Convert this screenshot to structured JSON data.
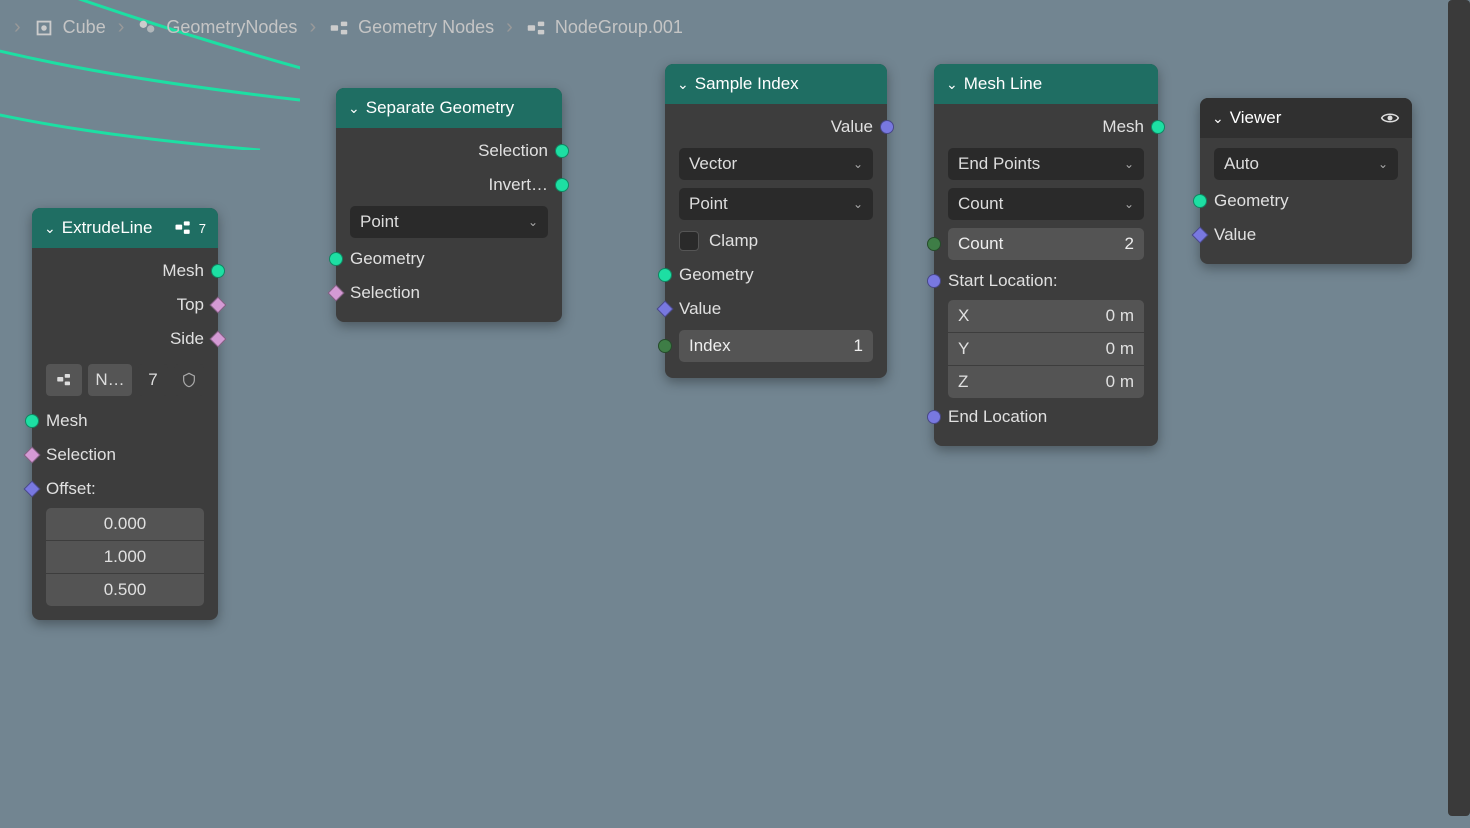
{
  "breadcrumb": [
    {
      "icon": "object",
      "label": "Cube"
    },
    {
      "icon": "modifier",
      "label": "GeometryNodes"
    },
    {
      "icon": "nodetree",
      "label": "Geometry Nodes"
    },
    {
      "icon": "nodetree",
      "label": "NodeGroup.001"
    }
  ],
  "nodes": {
    "extrude": {
      "title": "ExtrudeLine",
      "users": "7",
      "out_mesh": "Mesh",
      "out_top": "Top",
      "out_side": "Side",
      "datablock_name": "N…",
      "datablock_users": "7",
      "in_mesh": "Mesh",
      "in_selection": "Selection",
      "in_offset": "Offset:",
      "offset_x": "0.000",
      "offset_y": "1.000",
      "offset_z": "0.500"
    },
    "separate": {
      "title": "Separate Geometry",
      "out_selection": "Selection",
      "out_inverted": "Invert…",
      "domain": "Point",
      "in_geometry": "Geometry",
      "in_selection": "Selection"
    },
    "sample": {
      "title": "Sample Index",
      "out_value": "Value",
      "data_type": "Vector",
      "domain": "Point",
      "clamp": "Clamp",
      "in_geometry": "Geometry",
      "in_value": "Value",
      "index_label": "Index",
      "index_val": "1"
    },
    "meshline": {
      "title": "Mesh Line",
      "out_mesh": "Mesh",
      "mode": "End Points",
      "count_mode": "Count",
      "count_label": "Count",
      "count_val": "2",
      "start_label": "Start Location:",
      "start_x_label": "X",
      "start_x": "0 m",
      "start_y_label": "Y",
      "start_y": "0 m",
      "start_z_label": "Z",
      "start_z": "0 m",
      "end_label": "End Location"
    },
    "viewer": {
      "title": "Viewer",
      "domain": "Auto",
      "in_geometry": "Geometry",
      "in_value": "Value"
    }
  },
  "colors": {
    "geometry": "#1ddfa3",
    "boolean": "#d49ad4",
    "vector": "#7878e0",
    "integer": "#3e7d46",
    "float": "#9e9e9e",
    "header_teal": "#1f6e63",
    "node_bg": "#3d3d3d"
  }
}
